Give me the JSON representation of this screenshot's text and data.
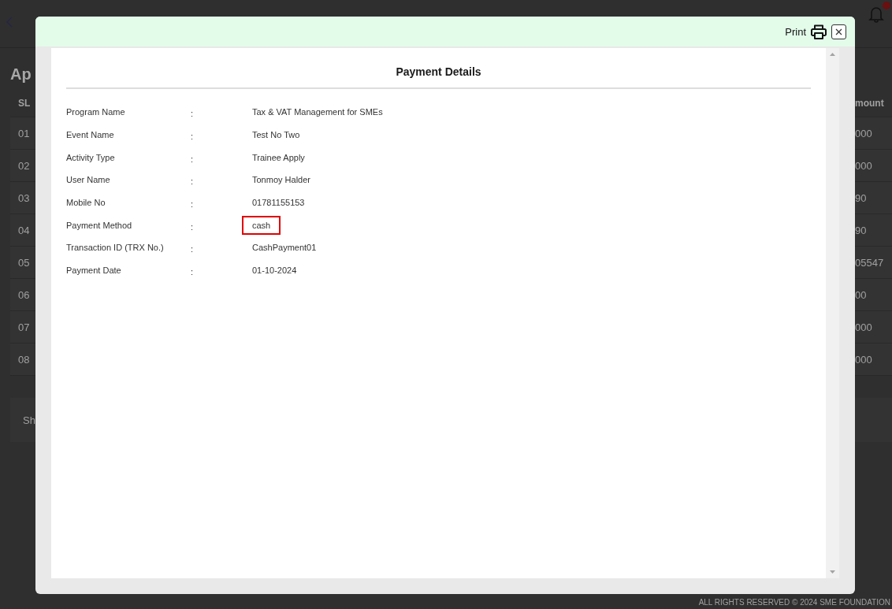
{
  "background_page": {
    "title": "Ap",
    "notification_count_visible": true,
    "table": {
      "columns": [
        "SL",
        "mount"
      ],
      "rows": [
        {
          "sl": "01",
          "amount": "000"
        },
        {
          "sl": "02",
          "amount": "000"
        },
        {
          "sl": "03",
          "amount": "90"
        },
        {
          "sl": "04",
          "amount": "90"
        },
        {
          "sl": "05",
          "amount": "05547"
        },
        {
          "sl": "06",
          "amount": "00"
        },
        {
          "sl": "07",
          "amount": "000"
        },
        {
          "sl": "08",
          "amount": "000"
        }
      ]
    },
    "footer_text": "Sh",
    "copyright": "ALL RIGHTS RESERVED © 2024 SME FOUNDATION"
  },
  "modal": {
    "print_label": "Print",
    "title": "Payment Details",
    "fields": [
      {
        "label": "Program Name",
        "separator": ":",
        "value": "Tax & VAT Management for SMEs",
        "highlighted": false
      },
      {
        "label": "Event Name",
        "separator": ":",
        "value": "Test No Two",
        "highlighted": false
      },
      {
        "label": "Activity Type",
        "separator": ":",
        "value": "Trainee Apply",
        "highlighted": false
      },
      {
        "label": "User Name",
        "separator": ":",
        "value": "Tonmoy Halder",
        "highlighted": false
      },
      {
        "label": "Mobile No",
        "separator": ":",
        "value": "01781155153",
        "highlighted": false
      },
      {
        "label": "Payment Method",
        "separator": ":",
        "value": "cash",
        "highlighted": true
      },
      {
        "label": "Transaction ID (TRX No.)",
        "separator": ":",
        "value": "CashPayment01",
        "highlighted": false
      },
      {
        "label": "Payment Date",
        "separator": ":",
        "value": "01-10-2024",
        "highlighted": false
      }
    ]
  }
}
